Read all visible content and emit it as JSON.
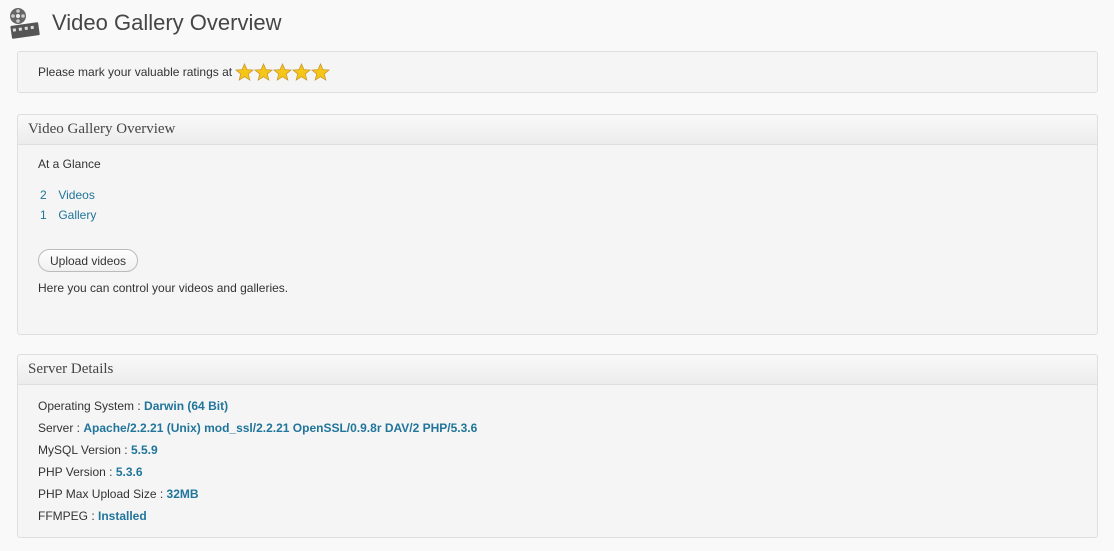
{
  "header": {
    "title": "Video Gallery Overview",
    "icon": "film-reel-icon"
  },
  "rating": {
    "text": "Please mark your valuable ratings at",
    "stars": 5,
    "star_color": "#f5c518"
  },
  "overview": {
    "title": "Video Gallery Overview",
    "glance_title": "At a Glance",
    "items": [
      {
        "count": "2",
        "label": "Videos"
      },
      {
        "count": "1",
        "label": "Gallery"
      }
    ],
    "upload_button": "Upload videos",
    "description": "Here you can control your videos and galleries."
  },
  "server": {
    "title": "Server Details",
    "rows": [
      {
        "label": "Operating System : ",
        "value": "Darwin (64 Bit)"
      },
      {
        "label": "Server : ",
        "value": "Apache/2.2.21 (Unix) mod_ssl/2.2.21 OpenSSL/0.9.8r DAV/2 PHP/5.3.6"
      },
      {
        "label": "MySQL Version : ",
        "value": "5.5.9"
      },
      {
        "label": "PHP Version : ",
        "value": "5.3.6"
      },
      {
        "label": "PHP Max Upload Size : ",
        "value": "32MB"
      },
      {
        "label": "FFMPEG : ",
        "value": "Installed"
      }
    ]
  },
  "colors": {
    "link": "#21759b",
    "background": "#f9f9f9",
    "box": "#f5f5f5"
  }
}
